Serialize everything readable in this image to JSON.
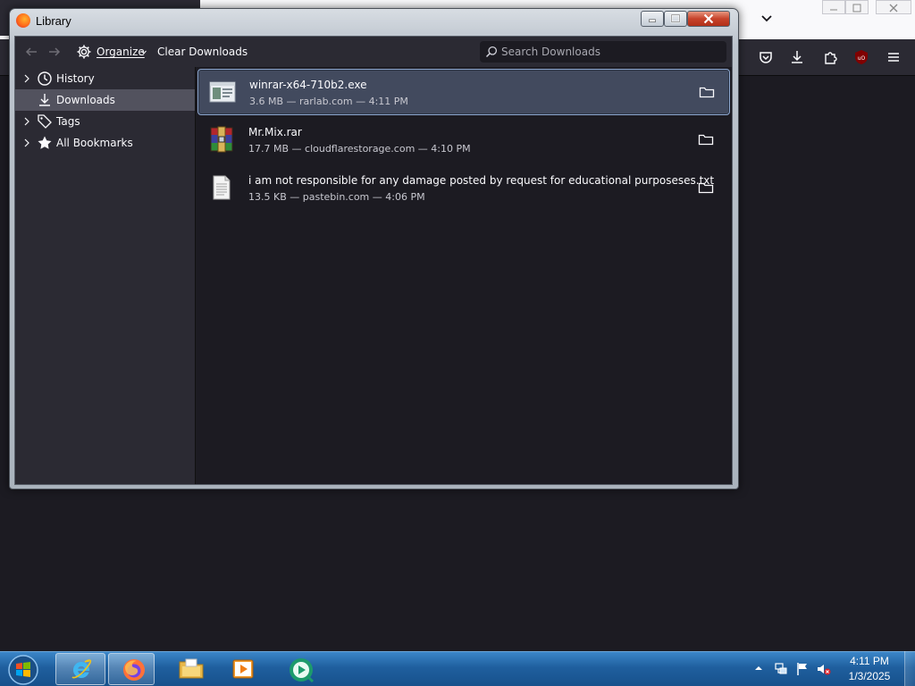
{
  "library": {
    "title": "Library",
    "toolbar": {
      "back_icon": "arrow-left-icon",
      "forward_icon": "arrow-right-icon",
      "organize_label": "Organize",
      "clear_label": "Clear Downloads",
      "search_placeholder": "Search Downloads",
      "search_value": ""
    },
    "sidebar": {
      "items": [
        {
          "label": "History",
          "icon": "clock-icon",
          "expandable": true,
          "selected": false
        },
        {
          "label": "Downloads",
          "icon": "download-icon",
          "expandable": false,
          "selected": true
        },
        {
          "label": "Tags",
          "icon": "tag-icon",
          "expandable": true,
          "selected": false
        },
        {
          "label": "All Bookmarks",
          "icon": "star-icon",
          "expandable": true,
          "selected": false
        }
      ]
    },
    "downloads": [
      {
        "name": "winrar-x64-710b2.exe",
        "meta": "3.6 MB — rarlab.com — 4:11 PM",
        "icon": "exe-icon",
        "selected": true
      },
      {
        "name": "Mr.Mix.rar",
        "meta": "17.7 MB — cloudflarestorage.com — 4:10 PM",
        "icon": "rar-archive-icon",
        "selected": false
      },
      {
        "name": "i am not responsible for any damage posted by request for educational purposeses.txt",
        "meta": "13.5 KB — pastebin.com — 4:06 PM",
        "icon": "text-file-icon",
        "selected": false
      }
    ]
  },
  "taskbar": {
    "apps": [
      "internet-explorer-icon",
      "firefox-icon",
      "file-explorer-icon",
      "media-player-icon",
      "streaming-app-icon"
    ],
    "clock_time": "4:11 PM",
    "clock_date": "1/3/2025"
  },
  "colors": {
    "panel": "#2b2a33",
    "content": "#1c1b22",
    "selection": "#424a5e",
    "text": "#fbfbfe"
  }
}
